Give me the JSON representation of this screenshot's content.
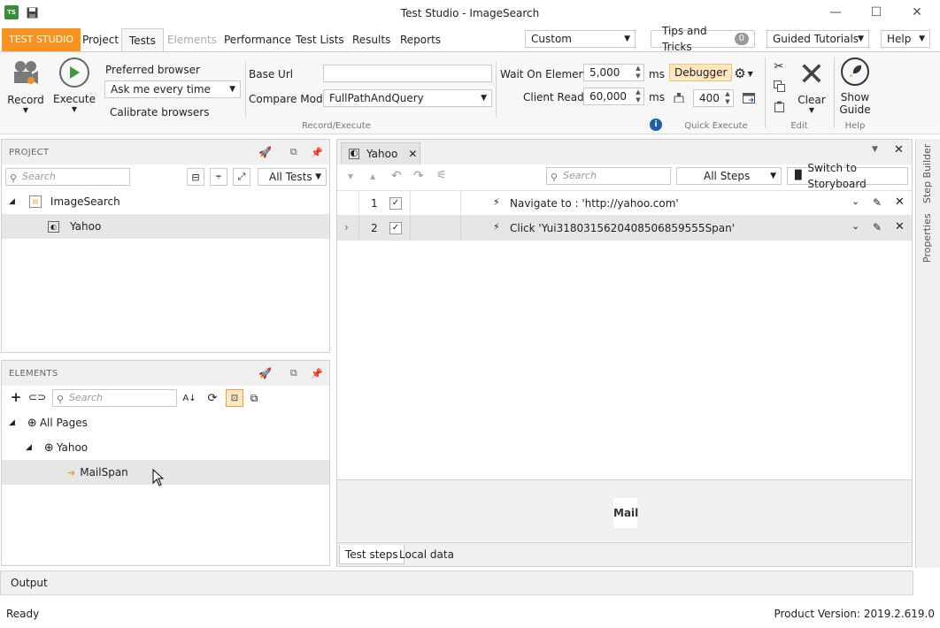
{
  "app": {
    "title": "Test Studio - ImageSearch",
    "badge": "TS"
  },
  "window_controls": {
    "minimize": "—",
    "maximize": "☐",
    "close": "✕"
  },
  "ribbon_tabs": [
    {
      "label": "TEST STUDIO"
    },
    {
      "label": "Project"
    },
    {
      "label": "Tests"
    },
    {
      "label": "Elements"
    },
    {
      "label": "Performance"
    },
    {
      "label": "Test Lists"
    },
    {
      "label": "Results"
    },
    {
      "label": "Reports"
    }
  ],
  "topbar": {
    "layout_combo": "Custom",
    "tips_label": "Tips and Tricks",
    "tips_count": "0",
    "guided_tutorials": "Guided Tutorials",
    "help": "Help"
  },
  "ribbon": {
    "record": "Record",
    "execute": "Execute",
    "preferred_browser_label": "Preferred browser",
    "preferred_browser_value": "Ask me every time",
    "calibrate": "Calibrate browsers",
    "base_url_label": "Base Url",
    "base_url_value": "",
    "compare_mode_label": "Compare Mode",
    "compare_mode_value": "FullPathAndQuery",
    "record_execute_group": "Record/Execute",
    "wait_label": "Wait On Elements",
    "wait_value": "5,000",
    "wait_unit": "ms",
    "client_ready_label": "Client Ready",
    "client_ready_value": "60,000",
    "client_ready_unit": "ms",
    "debugger": "Debugger",
    "speed_value": "400",
    "quick_execute_group": "Quick Execute",
    "clear": "Clear",
    "edit_group": "Edit",
    "show_guide_1": "Show",
    "show_guide_2": "Guide",
    "help_group": "Help"
  },
  "project_panel": {
    "title": "PROJECT",
    "search_placeholder": "Search",
    "filter": "All Tests",
    "tree": [
      {
        "label": "ImageSearch"
      },
      {
        "label": "Yahoo"
      }
    ]
  },
  "elements_panel": {
    "title": "ELEMENTS",
    "search_placeholder": "Search",
    "tree": [
      {
        "label": "All Pages"
      },
      {
        "label": "Yahoo"
      },
      {
        "label": "MailSpan"
      }
    ]
  },
  "editor": {
    "tab": "Yahoo",
    "search_placeholder": "Search",
    "steps_filter": "All Steps",
    "storyboard": "Switch to Storyboard",
    "steps": [
      {
        "num": "1",
        "text": "Navigate to : 'http://yahoo.com'"
      },
      {
        "num": "2",
        "text": "Click 'Yui3180315620408506859555Span'"
      }
    ],
    "preview_text": "Mail",
    "bottom_tabs": [
      {
        "label": "Test steps"
      },
      {
        "label": "Local data"
      }
    ]
  },
  "side_tabs": {
    "step_builder": "Step Builder",
    "properties": "Properties"
  },
  "output": {
    "label": "Output"
  },
  "status": {
    "left": "Ready",
    "right": "Product Version: 2019.2.619.0"
  },
  "colors": {
    "accent_orange": "#f7931e",
    "window_bg": "#f7f7f7"
  }
}
